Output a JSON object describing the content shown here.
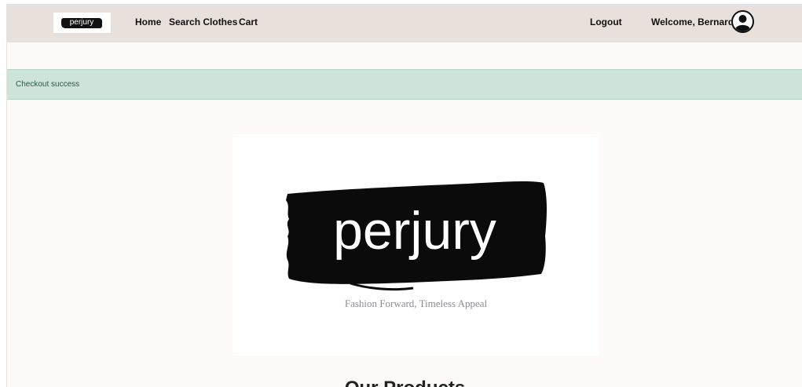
{
  "navbar": {
    "logo_text": "perjury",
    "links": [
      "Home",
      "Search Clothes",
      "Cart"
    ],
    "logout_label": "Logout",
    "welcome_text": "Welcome, Bernard",
    "avatar_icon": "user-circle-icon"
  },
  "alert": {
    "message": "Checkout success",
    "color": "#cfe4d9"
  },
  "hero": {
    "brand_text": "perjury",
    "tagline": "Fashion Forward, Timeless Appeal"
  },
  "products": {
    "heading": "Our Products"
  }
}
